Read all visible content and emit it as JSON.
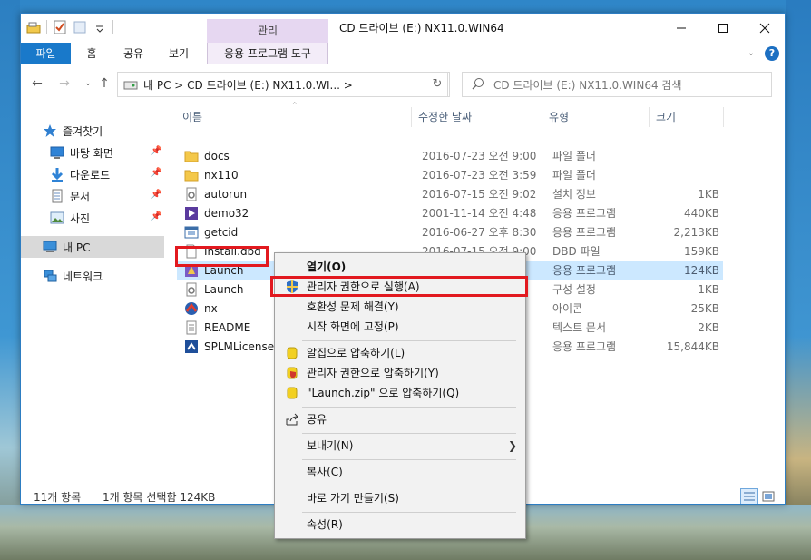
{
  "window": {
    "title": "CD 드라이브 (E:) NX11.0.WIN64",
    "contextual_tab_group": "관리"
  },
  "ribbon": {
    "tabs": [
      "파일",
      "홈",
      "공유",
      "보기",
      "응용 프로그램 도구"
    ]
  },
  "address_bar": {
    "path": "내 PC  >  CD 드라이브 (E:) NX11.0.WI...  >",
    "search_placeholder": "CD 드라이브 (E:) NX11.0.WIN64 검색"
  },
  "nav_pane": {
    "quick_access": "즐겨찾기",
    "items": [
      {
        "label": "바탕 화면",
        "icon": "desktop-icon",
        "pinned": true
      },
      {
        "label": "다운로드",
        "icon": "download-icon",
        "pinned": true
      },
      {
        "label": "문서",
        "icon": "documents-icon",
        "pinned": true
      },
      {
        "label": "사진",
        "icon": "pictures-icon",
        "pinned": true
      }
    ],
    "this_pc": "내 PC",
    "network": "네트워크"
  },
  "columns": {
    "name": "이름",
    "date": "수정한 날짜",
    "type": "유형",
    "size": "크기"
  },
  "files": [
    {
      "name": "docs",
      "date": "2016-07-23 오전 9:00",
      "type": "파일 폴더",
      "size": "",
      "icon": "folder-icon"
    },
    {
      "name": "nx110",
      "date": "2016-07-23 오전 3:59",
      "type": "파일 폴더",
      "size": "",
      "icon": "folder-icon"
    },
    {
      "name": "autorun",
      "date": "2016-07-15 오전 9:02",
      "type": "설치 정보",
      "size": "1KB",
      "icon": "setup-info-icon"
    },
    {
      "name": "demo32",
      "date": "2001-11-14 오전 4:48",
      "type": "응용 프로그램",
      "size": "440KB",
      "icon": "app-icon"
    },
    {
      "name": "getcid",
      "date": "2016-06-27 오후 8:30",
      "type": "응용 프로그램",
      "size": "2,213KB",
      "icon": "app-window-icon"
    },
    {
      "name": "Install.dbd",
      "date": "2016-07-15 오전 9:00",
      "type": "DBD 파일",
      "size": "159KB",
      "icon": "file-icon"
    },
    {
      "name": "Launch",
      "date": "",
      "type": "응용 프로그램",
      "size": "124KB",
      "icon": "launch-app-icon",
      "selected": true
    },
    {
      "name": "Launch",
      "date": "",
      "type": "구성 설정",
      "size": "1KB",
      "icon": "config-icon"
    },
    {
      "name": "nx",
      "date": "",
      "type": "아이콘",
      "size": "25KB",
      "icon": "nx-icon"
    },
    {
      "name": "README",
      "date": "",
      "type": "텍스트 문서",
      "size": "2KB",
      "icon": "text-doc-icon"
    },
    {
      "name": "SPLMLicenseSe",
      "date": "",
      "type": "응용 프로그램",
      "size": "15,844KB",
      "icon": "installer-icon"
    }
  ],
  "partial_dates": {
    "nx": "6",
    "readme": "0"
  },
  "status": {
    "count": "11개 항목",
    "selection": "1개 항목 선택함 124KB"
  },
  "context_menu": {
    "items": [
      {
        "label": "열기(O)",
        "bold": true
      },
      {
        "label": "관리자 권한으로 실행(A)",
        "icon": "uac-shield-icon"
      },
      {
        "label": "호환성 문제 해결(Y)"
      },
      {
        "label": "시작 화면에 고정(P)"
      },
      {
        "label": "알집으로 압축하기(L)",
        "icon": "alzip-icon"
      },
      {
        "label": "관리자 권한으로 압축하기(Y)",
        "icon": "alzip-shield-icon"
      },
      {
        "label": "\"Launch.zip\" 으로 압축하기(Q)",
        "icon": "alzip-icon"
      },
      {
        "label": "공유",
        "icon": "share-icon"
      },
      {
        "label": "보내기(N)",
        "submenu": true
      },
      {
        "label": "복사(C)"
      },
      {
        "label": "바로 가기 만들기(S)"
      },
      {
        "label": "속성(R)"
      }
    ]
  },
  "colors": {
    "accent": "#1979ca",
    "selection": "#cce8ff",
    "highlight_box": "#e2191f",
    "contextual_tab": "#e6d7f1"
  }
}
